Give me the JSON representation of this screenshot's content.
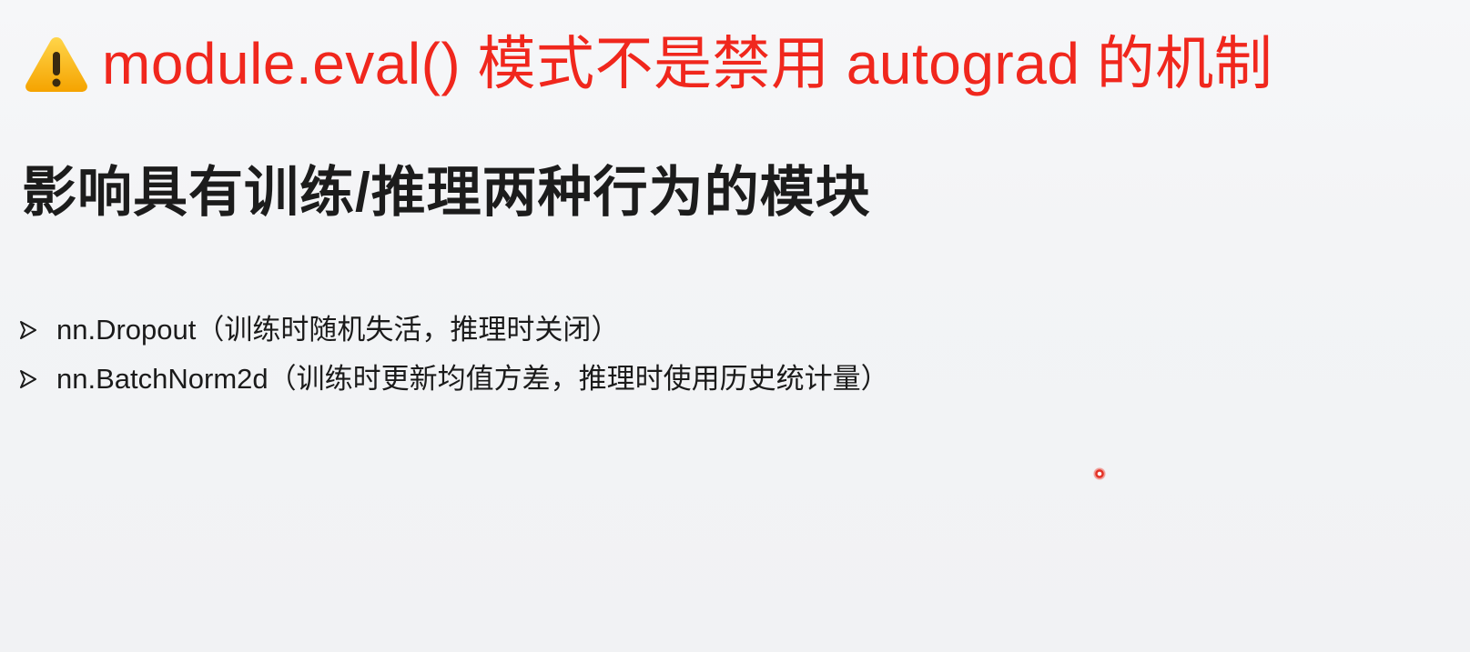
{
  "title": {
    "icon": "warning-icon",
    "text": "module.eval() 模式不是禁用 autograd 的机制",
    "color": "#f0271d"
  },
  "subtitle": "影响具有训练/推理两种行为的模块",
  "bullets": [
    {
      "marker": "arrow-bullet-icon",
      "text": "nn.Dropout（训练时随机失活，推理时关闭）"
    },
    {
      "marker": "arrow-bullet-icon",
      "text": "nn.BatchNorm2d（训练时更新均值方差，推理时使用历史统计量）"
    }
  ],
  "cursor": {
    "icon": "pointer-dot-icon",
    "color": "#e33226"
  }
}
